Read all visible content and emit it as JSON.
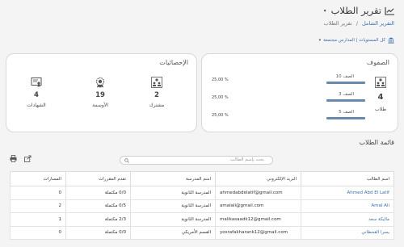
{
  "header": {
    "title": "تقرير الطلاب",
    "caret": "▾",
    "breadcrumb": {
      "link": "التقرير الشامل",
      "sep": "/",
      "current": "تقرير الطلاب"
    },
    "filter": "كل المستويات | المدارس مجتمعة",
    "filter_caret": "▾"
  },
  "classes_card": {
    "title": "الصفوف",
    "count": "4",
    "count_label": "طلاب",
    "rows": [
      {
        "name": "الصف 10",
        "pct": "25,00 %",
        "fraction": 0.25
      },
      {
        "name": "الصف 3",
        "pct": "25,00 %",
        "fraction": 0.25
      },
      {
        "name": "الصف 5",
        "pct": "25,00 %",
        "fraction": 0.25
      }
    ]
  },
  "stats_card": {
    "title": "الإحصائيات",
    "items": [
      {
        "value": "2",
        "label": "مشترك",
        "icon": "users-icon"
      },
      {
        "value": "19",
        "label": "الأوسمة",
        "icon": "badge-icon"
      },
      {
        "value": "4",
        "label": "الشهادات",
        "icon": "certificate-icon"
      }
    ]
  },
  "students": {
    "title": "قائمة الطلاب",
    "search_placeholder": "بحث بإسم الطالب",
    "columns": [
      "اسم الطالب",
      "البريد الإلكتروني",
      "اسم المدرسة",
      "تقدم المقررات",
      "المسارات"
    ],
    "rows": [
      {
        "name": "Ahmed Abd El Latif",
        "email": "ahmedabdelatif@gmail.com",
        "school": "المدرسة الثانوية",
        "progress": "0/0 مكتملة",
        "tracks": "0"
      },
      {
        "name": "Amal Ali",
        "email": "amalali@gmail.com",
        "school": "المدرسة الثانوية",
        "progress": "0/5 مكتملة",
        "tracks": "2"
      },
      {
        "name": "ماليكة سعد",
        "email": "malikasaadk12@gmail.com",
        "school": "المدرسة الثانوية",
        "progress": "2/3 مكتملة",
        "tracks": "1"
      },
      {
        "name": "يسرا القحطاني",
        "email": "yosrafakharank12@gmail.com",
        "school": "القسم الأمريكي",
        "progress": "0/0 مكتملة",
        "tracks": "0"
      }
    ]
  },
  "colors": {
    "link": "#3a6fa8",
    "bar": "#6789ac",
    "background": "#f4f4f4"
  }
}
